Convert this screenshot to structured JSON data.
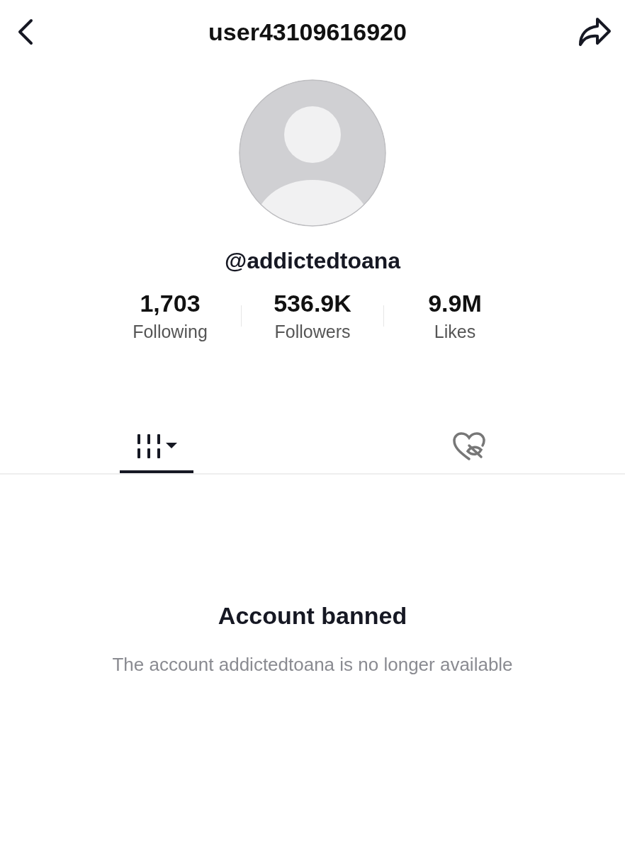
{
  "header": {
    "title": "user43109616920"
  },
  "profile": {
    "handle": "@addictedtoana"
  },
  "stats": [
    {
      "value": "1,703",
      "label": "Following"
    },
    {
      "value": "536.9K",
      "label": "Followers"
    },
    {
      "value": "9.9M",
      "label": "Likes"
    }
  ],
  "tabs": [
    {
      "kind": "videos",
      "selected": true
    },
    {
      "kind": "liked",
      "selected": false
    }
  ],
  "notice": {
    "title": "Account banned",
    "message": "The account addictedtoana is no longer available"
  }
}
